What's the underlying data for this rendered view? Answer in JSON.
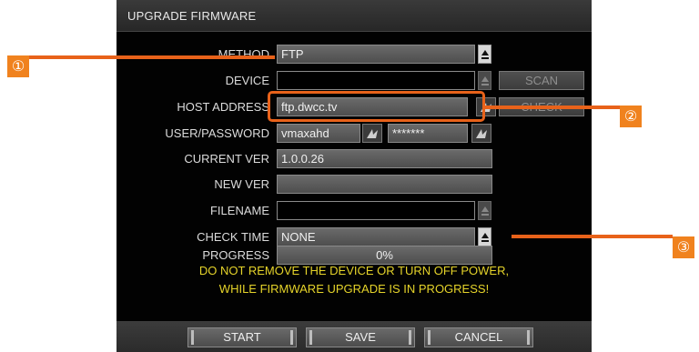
{
  "dialog": {
    "title": "UPGRADE FIRMWARE",
    "labels": {
      "method": "METHOD",
      "device": "DEVICE",
      "host": "HOST ADDRESS",
      "userpass": "USER/PASSWORD",
      "current": "CURRENT VER",
      "newver": "NEW VER",
      "filename": "FILENAME",
      "checktime": "CHECK TIME",
      "progress": "PROGRESS"
    },
    "values": {
      "method": "FTP",
      "device": "",
      "host": "ftp.dwcc.tv",
      "user": "vmaxahd",
      "password": "*******",
      "current": "1.0.0.26",
      "newver": "",
      "filename": "",
      "checktime": "NONE",
      "progress_text": "0%"
    },
    "side_buttons": {
      "scan": "SCAN",
      "check": "CHECK"
    },
    "warning_line1": "DO NOT REMOVE THE DEVICE OR TURN OFF POWER,",
    "warning_line2": "WHILE FIRMWARE UPGRADE IS IN PROGRESS!",
    "buttons": {
      "start": "START",
      "save": "SAVE",
      "cancel": "CANCEL"
    }
  },
  "callouts": {
    "one": "①",
    "two": "②",
    "three": "③"
  },
  "colors": {
    "accent": "#e8621a",
    "warning": "#e6d42a"
  }
}
